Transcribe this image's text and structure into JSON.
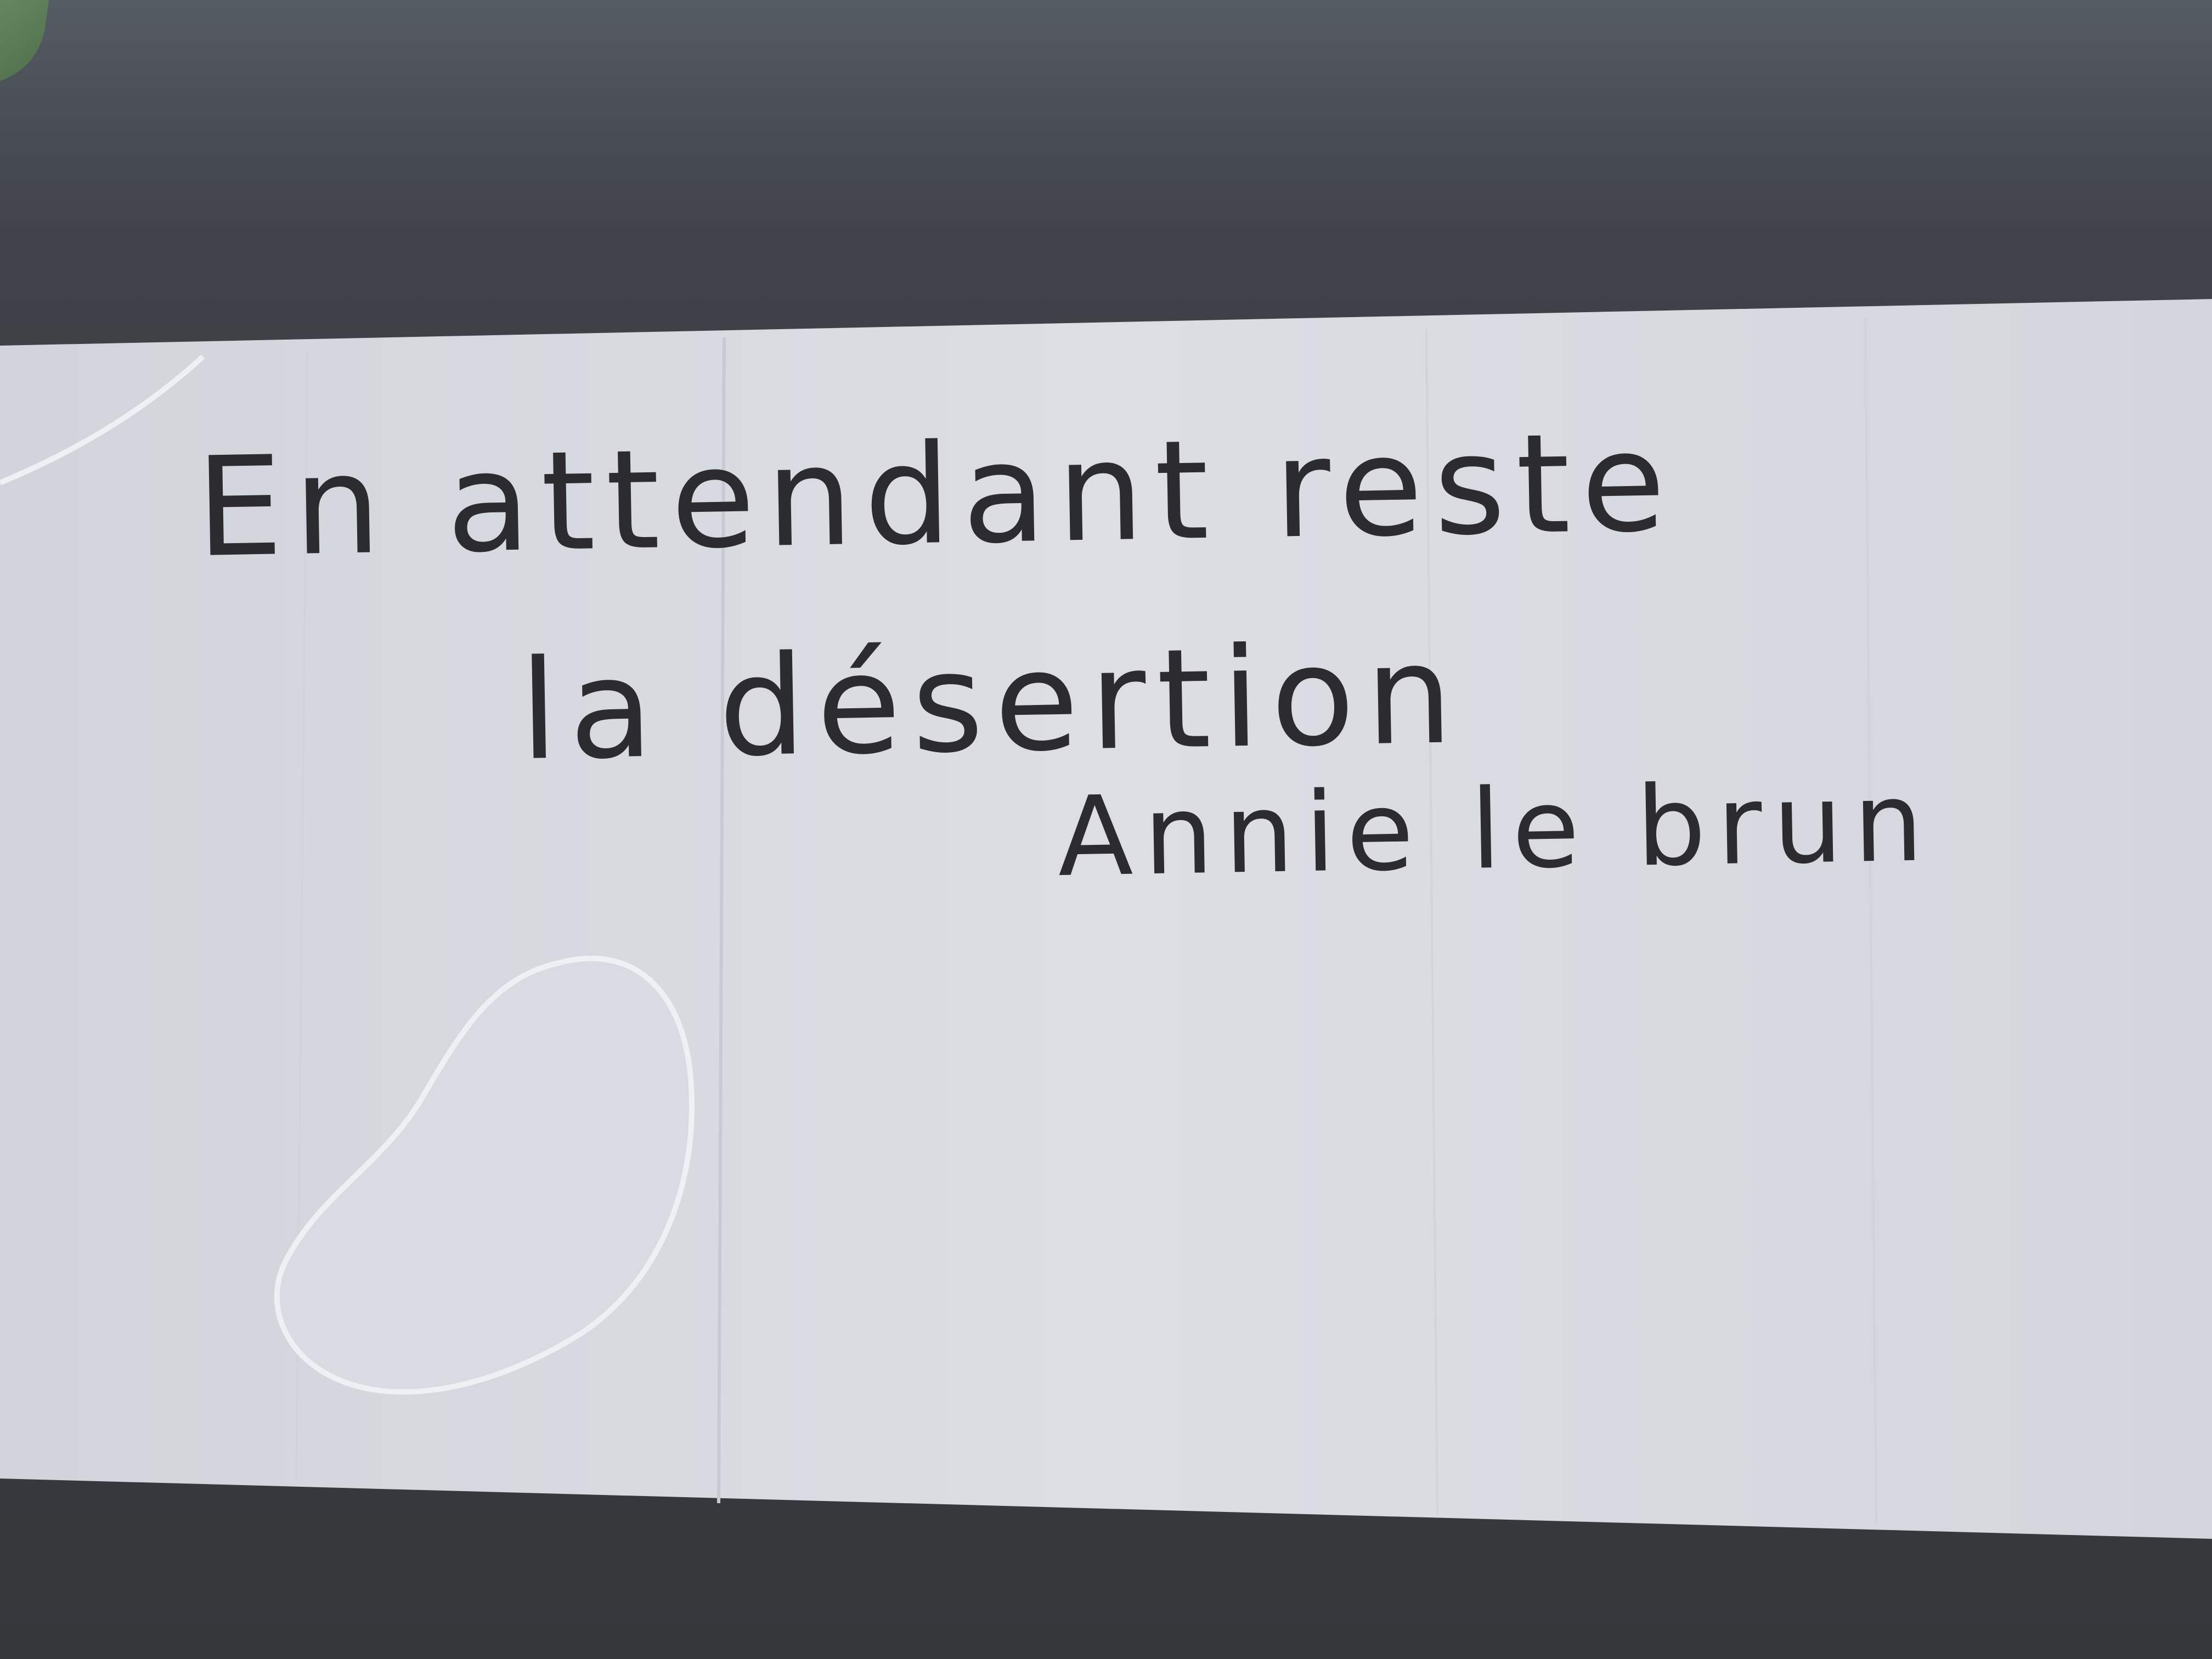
{
  "paper": {
    "color": "#d6d8df"
  },
  "background": {
    "color": "#3c3f44"
  },
  "handwriting": {
    "line1": "En attendant reste",
    "line2": "la désertion",
    "signature": "Annie le brun",
    "ink_color": "#2b2b30"
  }
}
